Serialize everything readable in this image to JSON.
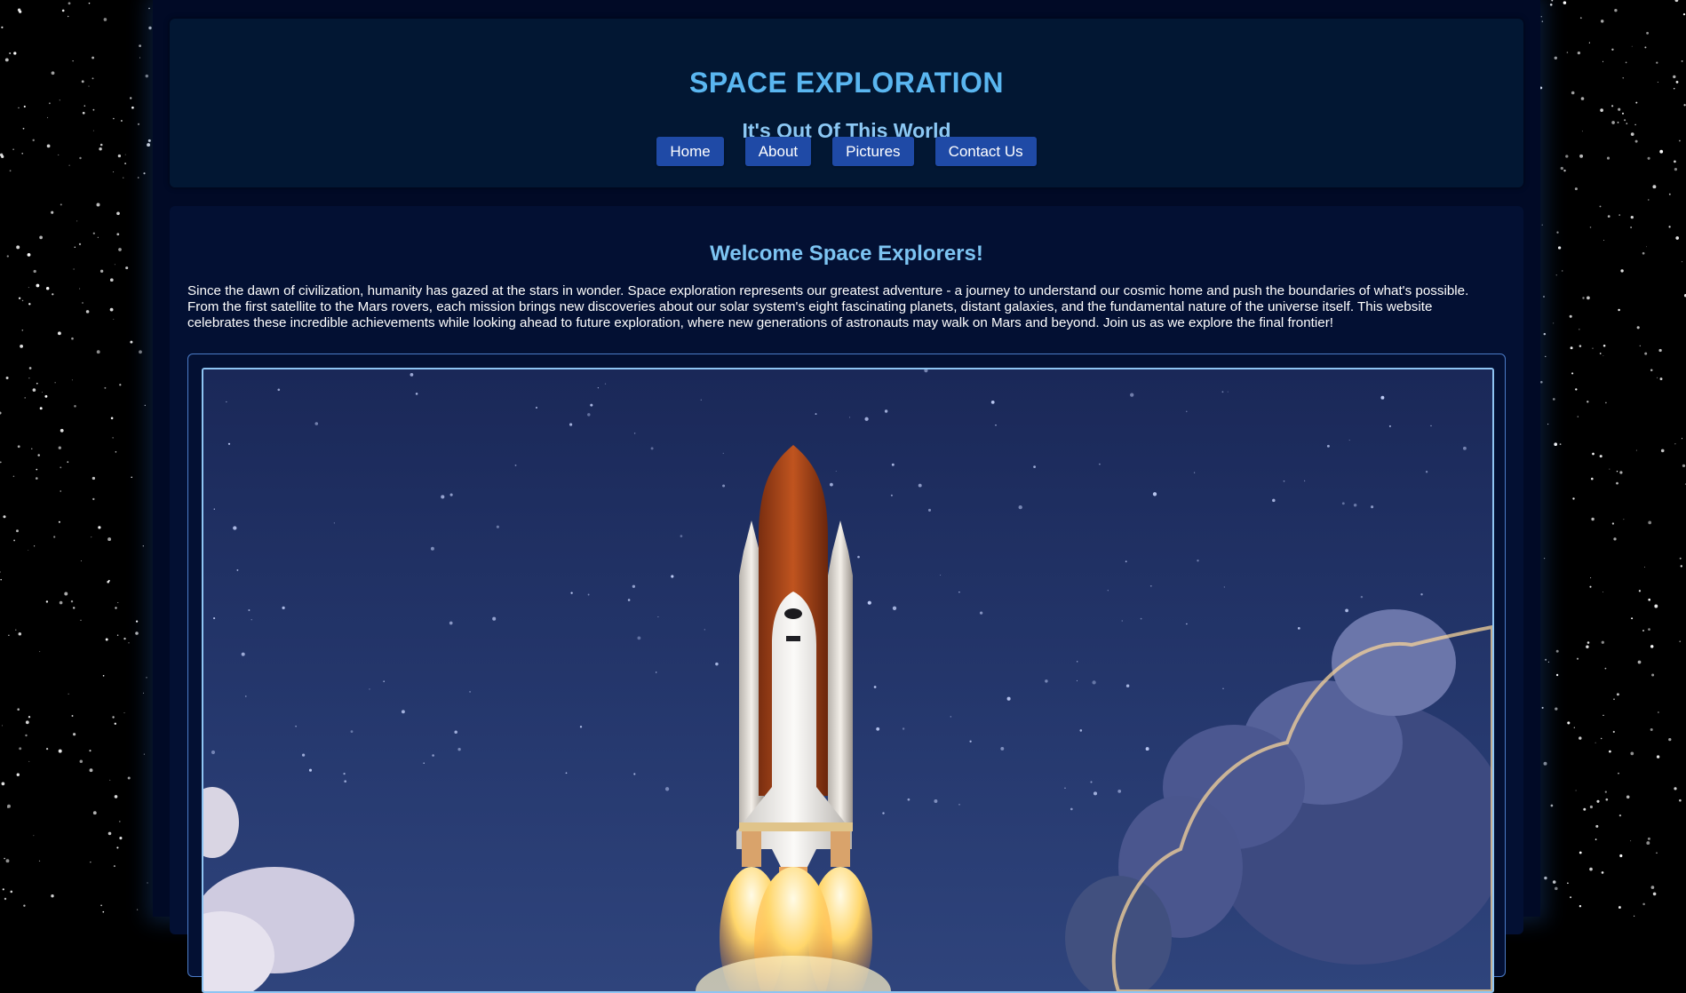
{
  "header": {
    "title": "SPACE EXPLORATION",
    "tagline": "It's Out Of This World"
  },
  "nav": {
    "items": [
      {
        "label": "Home"
      },
      {
        "label": "About"
      },
      {
        "label": "Pictures"
      },
      {
        "label": "Contact Us"
      }
    ]
  },
  "main": {
    "heading": "Welcome Space Explorers!",
    "intro": "Since the dawn of civilization, humanity has gazed at the stars in wonder. Space exploration represents our greatest adventure - a journey to understand our cosmic home and push the boundaries of what's possible. From the first satellite to the Mars rovers, each mission brings new discoveries about our solar system's eight fascinating planets, distant galaxies, and the fundamental nature of the universe itself. This website celebrates these incredible achievements while looking ahead to future exploration, where new generations of astronauts may walk on Mars and beyond. Join us as we explore the final frontier!"
  },
  "colors": {
    "title": "#5ab6f0",
    "nav_button": "#1f4aa6",
    "page_background": "#010a26"
  }
}
